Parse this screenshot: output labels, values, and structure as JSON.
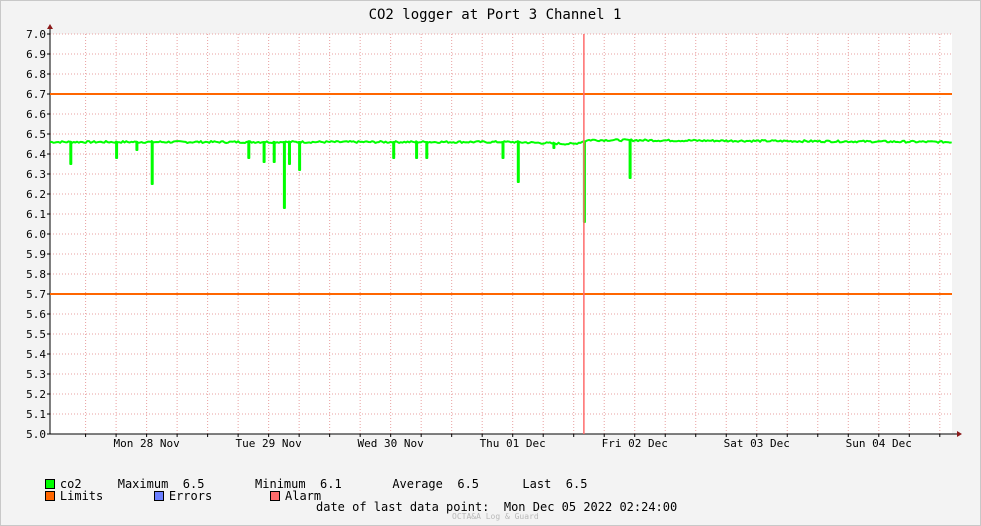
{
  "chart_data": {
    "type": "line",
    "title": "CO2 logger at Port 3 Channel 1",
    "ylim": [
      5.0,
      7.0
    ],
    "yticks": [
      "5.0",
      "5.1",
      "5.2",
      "5.3",
      "5.4",
      "5.5",
      "5.6",
      "5.7",
      "5.8",
      "5.9",
      "6.0",
      "6.1",
      "6.2",
      "6.3",
      "6.4",
      "6.5",
      "6.6",
      "6.7",
      "6.8",
      "6.9",
      "7.0"
    ],
    "xlim": [
      "2022-11-27 17:00",
      "2022-12-05 02:24"
    ],
    "x_tick_labels": [
      {
        "at": "2022-11-28 12:00",
        "label": "Mon 28 Nov"
      },
      {
        "at": "2022-11-29 12:00",
        "label": "Tue 29 Nov"
      },
      {
        "at": "2022-11-30 12:00",
        "label": "Wed 30 Nov"
      },
      {
        "at": "2022-12-01 12:00",
        "label": "Thu 01 Dec"
      },
      {
        "at": "2022-12-02 12:00",
        "label": "Fri 02 Dec"
      },
      {
        "at": "2022-12-03 12:00",
        "label": "Sat 03 Dec"
      },
      {
        "at": "2022-12-04 12:00",
        "label": "Sun 04 Dec"
      }
    ],
    "limits": [
      6.7,
      5.7
    ],
    "alarm_at": "2022-12-02 02:00",
    "grid": true,
    "colors": {
      "co2": "#00ff00",
      "limits": "#ff6600",
      "errors": "#6b7fff",
      "alarm": "#ff6b6b",
      "grid": "#e8a0a0",
      "axis": "#000000",
      "arrow": "#8b1a1a"
    },
    "series": [
      {
        "name": "co2",
        "baseline": 6.46,
        "baseline_drift": [
          [
            "2022-11-27 17:00",
            6.46
          ],
          [
            "2022-12-01 12:00",
            6.46
          ],
          [
            "2022-12-02 00:00",
            6.45
          ],
          [
            "2022-12-02 03:00",
            6.47
          ],
          [
            "2022-12-05 02:24",
            6.46
          ]
        ],
        "dips": [
          [
            "2022-11-27 21:00",
            6.35
          ],
          [
            "2022-11-28 06:00",
            6.38
          ],
          [
            "2022-11-28 10:00",
            6.42
          ],
          [
            "2022-11-28 13:00",
            6.25
          ],
          [
            "2022-11-29 08:00",
            6.38
          ],
          [
            "2022-11-29 11:00",
            6.36
          ],
          [
            "2022-11-29 13:00",
            6.36
          ],
          [
            "2022-11-29 15:00",
            6.13
          ],
          [
            "2022-11-29 16:00",
            6.35
          ],
          [
            "2022-11-29 18:00",
            6.32
          ],
          [
            "2022-11-30 12:30",
            6.38
          ],
          [
            "2022-11-30 17:00",
            6.38
          ],
          [
            "2022-11-30 19:00",
            6.38
          ],
          [
            "2022-12-01 10:00",
            6.38
          ],
          [
            "2022-12-01 13:00",
            6.26
          ],
          [
            "2022-12-01 20:00",
            6.43
          ],
          [
            "2022-12-02 02:00",
            6.06
          ],
          [
            "2022-12-02 11:00",
            6.28
          ]
        ]
      }
    ]
  },
  "legend": {
    "co2_label": "co2",
    "max_label": "Maximum",
    "max_value": "6.5",
    "min_label": "Minimum",
    "min_value": "6.1",
    "avg_label": "Average",
    "avg_value": "6.5",
    "last_label": "Last",
    "last_value": "6.5",
    "limits_label": "Limits",
    "errors_label": "Errors",
    "alarm_label": "Alarm"
  },
  "footer": {
    "label": "date of last data point:",
    "value": "Mon Dec 05 2022 02:24:00"
  },
  "watermark": "OCTA&A Log & Guard"
}
